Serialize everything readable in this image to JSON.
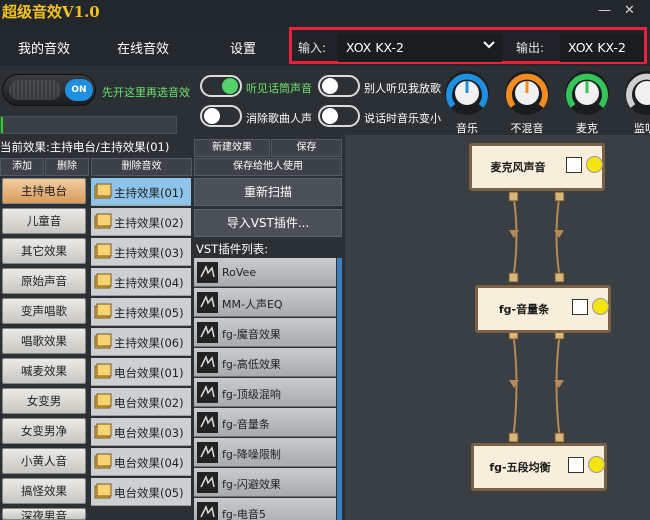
{
  "window": {
    "title": "超级音效V1.0",
    "min": "—",
    "close": "✕"
  },
  "menu": {
    "items": [
      "我的音效",
      "在线音效",
      "设置"
    ],
    "input_label": "输入:",
    "input_value": "XOX KX-2",
    "output_label": "输出:",
    "output_value": "XOX KX-2"
  },
  "power": {
    "state_label": "ON",
    "hint": "先开这里再选音效"
  },
  "progress_percent": 1,
  "toggles": [
    {
      "label": "听见话筒声音",
      "on": true
    },
    {
      "label": "别人听见我放歌",
      "on": false
    },
    {
      "label": "消除歌曲人声",
      "on": false
    },
    {
      "label": "说话时音乐变小",
      "on": false
    }
  ],
  "knobs": [
    {
      "label": "音乐",
      "color": "#1f8fe0"
    },
    {
      "label": "不混音",
      "color": "#f28b21"
    },
    {
      "label": "麦克",
      "color": "#34c45a"
    },
    {
      "label": "监听",
      "color": "#cfcfcf"
    }
  ],
  "current_effect": "当前效果:主持电台/主持效果(01)",
  "category_actions": [
    "添加",
    "删除"
  ],
  "preset_action": "删除音效",
  "vst_actions": [
    "新建效果",
    "保存",
    "保存给他人使用"
  ],
  "rescan": "重新扫描",
  "import_vst": "导入VST插件...",
  "vst_list_title": "VST插件列表:",
  "categories": [
    "主持电台",
    "儿童音",
    "其它效果",
    "原始声音",
    "变声唱歌",
    "唱歌效果",
    "喊麦效果",
    "女变男",
    "女变男净",
    "小黄人音",
    "搞怪效果",
    "深夜男音"
  ],
  "selected_category": 0,
  "presets": [
    "主持效果(01)",
    "主持效果(02)",
    "主持效果(03)",
    "主持效果(04)",
    "主持效果(05)",
    "主持效果(06)",
    "电台效果(01)",
    "电台效果(02)",
    "电台效果(03)",
    "电台效果(04)",
    "电台效果(05)"
  ],
  "selected_preset": 0,
  "vst_plugins": [
    "RoVee",
    "MM-人声EQ",
    "fg-魔音效果",
    "fg-高低效果",
    "fg-顶级混响",
    "fg-音量条",
    "fg-降噪限制",
    "fg-闪避效果",
    "fg-电音5"
  ],
  "chain_nodes": [
    "麦克风声音",
    "fg-音量条",
    "fg-五段均衡"
  ],
  "colors": {
    "accent_blue": "#1f8fe0",
    "highlight_red": "#e8223c",
    "title_yellow": "#f3c21f",
    "hint_green": "#6ee26e",
    "node_dot": "#f4e511"
  }
}
